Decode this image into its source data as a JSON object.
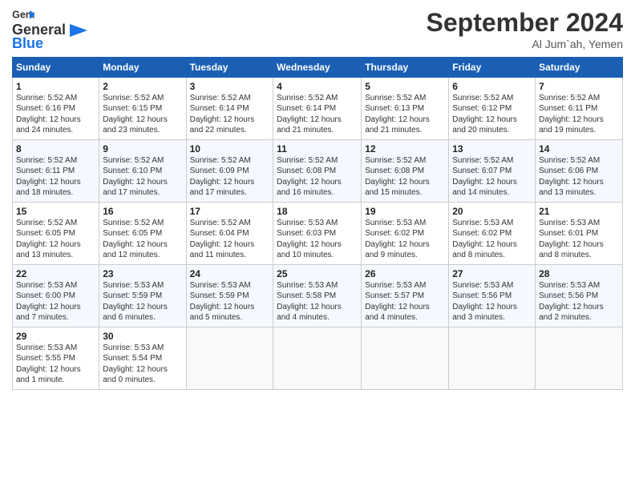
{
  "header": {
    "logo_line1": "General",
    "logo_line2": "Blue",
    "month_title": "September 2024",
    "location": "Al Jum`ah, Yemen"
  },
  "weekdays": [
    "Sunday",
    "Monday",
    "Tuesday",
    "Wednesday",
    "Thursday",
    "Friday",
    "Saturday"
  ],
  "weeks": [
    [
      {
        "day": "1",
        "sunrise": "5:52 AM",
        "sunset": "6:16 PM",
        "daylight": "12 hours and 24 minutes."
      },
      {
        "day": "2",
        "sunrise": "5:52 AM",
        "sunset": "6:15 PM",
        "daylight": "12 hours and 23 minutes."
      },
      {
        "day": "3",
        "sunrise": "5:52 AM",
        "sunset": "6:14 PM",
        "daylight": "12 hours and 22 minutes."
      },
      {
        "day": "4",
        "sunrise": "5:52 AM",
        "sunset": "6:14 PM",
        "daylight": "12 hours and 21 minutes."
      },
      {
        "day": "5",
        "sunrise": "5:52 AM",
        "sunset": "6:13 PM",
        "daylight": "12 hours and 21 minutes."
      },
      {
        "day": "6",
        "sunrise": "5:52 AM",
        "sunset": "6:12 PM",
        "daylight": "12 hours and 20 minutes."
      },
      {
        "day": "7",
        "sunrise": "5:52 AM",
        "sunset": "6:11 PM",
        "daylight": "12 hours and 19 minutes."
      }
    ],
    [
      {
        "day": "8",
        "sunrise": "5:52 AM",
        "sunset": "6:11 PM",
        "daylight": "12 hours and 18 minutes."
      },
      {
        "day": "9",
        "sunrise": "5:52 AM",
        "sunset": "6:10 PM",
        "daylight": "12 hours and 17 minutes."
      },
      {
        "day": "10",
        "sunrise": "5:52 AM",
        "sunset": "6:09 PM",
        "daylight": "12 hours and 17 minutes."
      },
      {
        "day": "11",
        "sunrise": "5:52 AM",
        "sunset": "6:08 PM",
        "daylight": "12 hours and 16 minutes."
      },
      {
        "day": "12",
        "sunrise": "5:52 AM",
        "sunset": "6:08 PM",
        "daylight": "12 hours and 15 minutes."
      },
      {
        "day": "13",
        "sunrise": "5:52 AM",
        "sunset": "6:07 PM",
        "daylight": "12 hours and 14 minutes."
      },
      {
        "day": "14",
        "sunrise": "5:52 AM",
        "sunset": "6:06 PM",
        "daylight": "12 hours and 13 minutes."
      }
    ],
    [
      {
        "day": "15",
        "sunrise": "5:52 AM",
        "sunset": "6:05 PM",
        "daylight": "12 hours and 13 minutes."
      },
      {
        "day": "16",
        "sunrise": "5:52 AM",
        "sunset": "6:05 PM",
        "daylight": "12 hours and 12 minutes."
      },
      {
        "day": "17",
        "sunrise": "5:52 AM",
        "sunset": "6:04 PM",
        "daylight": "12 hours and 11 minutes."
      },
      {
        "day": "18",
        "sunrise": "5:53 AM",
        "sunset": "6:03 PM",
        "daylight": "12 hours and 10 minutes."
      },
      {
        "day": "19",
        "sunrise": "5:53 AM",
        "sunset": "6:02 PM",
        "daylight": "12 hours and 9 minutes."
      },
      {
        "day": "20",
        "sunrise": "5:53 AM",
        "sunset": "6:02 PM",
        "daylight": "12 hours and 8 minutes."
      },
      {
        "day": "21",
        "sunrise": "5:53 AM",
        "sunset": "6:01 PM",
        "daylight": "12 hours and 8 minutes."
      }
    ],
    [
      {
        "day": "22",
        "sunrise": "5:53 AM",
        "sunset": "6:00 PM",
        "daylight": "12 hours and 7 minutes."
      },
      {
        "day": "23",
        "sunrise": "5:53 AM",
        "sunset": "5:59 PM",
        "daylight": "12 hours and 6 minutes."
      },
      {
        "day": "24",
        "sunrise": "5:53 AM",
        "sunset": "5:59 PM",
        "daylight": "12 hours and 5 minutes."
      },
      {
        "day": "25",
        "sunrise": "5:53 AM",
        "sunset": "5:58 PM",
        "daylight": "12 hours and 4 minutes."
      },
      {
        "day": "26",
        "sunrise": "5:53 AM",
        "sunset": "5:57 PM",
        "daylight": "12 hours and 4 minutes."
      },
      {
        "day": "27",
        "sunrise": "5:53 AM",
        "sunset": "5:56 PM",
        "daylight": "12 hours and 3 minutes."
      },
      {
        "day": "28",
        "sunrise": "5:53 AM",
        "sunset": "5:56 PM",
        "daylight": "12 hours and 2 minutes."
      }
    ],
    [
      {
        "day": "29",
        "sunrise": "5:53 AM",
        "sunset": "5:55 PM",
        "daylight": "12 hours and 1 minute."
      },
      {
        "day": "30",
        "sunrise": "5:53 AM",
        "sunset": "5:54 PM",
        "daylight": "12 hours and 0 minutes."
      },
      null,
      null,
      null,
      null,
      null
    ]
  ]
}
